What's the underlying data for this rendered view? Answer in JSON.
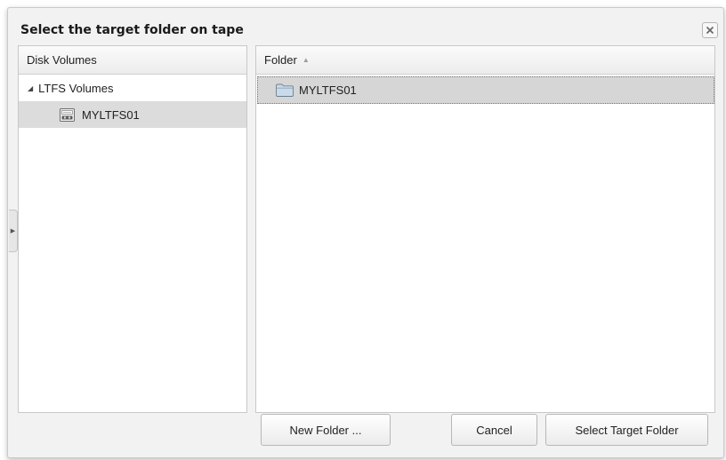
{
  "dialog": {
    "title": "Select the target folder on tape",
    "close_icon": "close-icon"
  },
  "left_panel": {
    "header": "Disk Volumes",
    "tree": {
      "root_label": "LTFS Volumes",
      "root_expanded": true,
      "children": [
        {
          "label": "MYLTFS01",
          "icon": "tape-volume-icon",
          "selected": true
        }
      ]
    }
  },
  "right_panel": {
    "header": "Folder",
    "sort_icon": "sort-ascending-icon",
    "rows": [
      {
        "label": "MYLTFS01",
        "icon": "folder-icon",
        "selected": true
      }
    ]
  },
  "buttons": {
    "new_folder": "New Folder ...",
    "cancel": "Cancel",
    "select_target": "Select Target Folder"
  },
  "colors": {
    "dialog_bg": "#f2f2f2",
    "selection_bg": "#dcdcdc",
    "border": "#c8c8c8"
  }
}
